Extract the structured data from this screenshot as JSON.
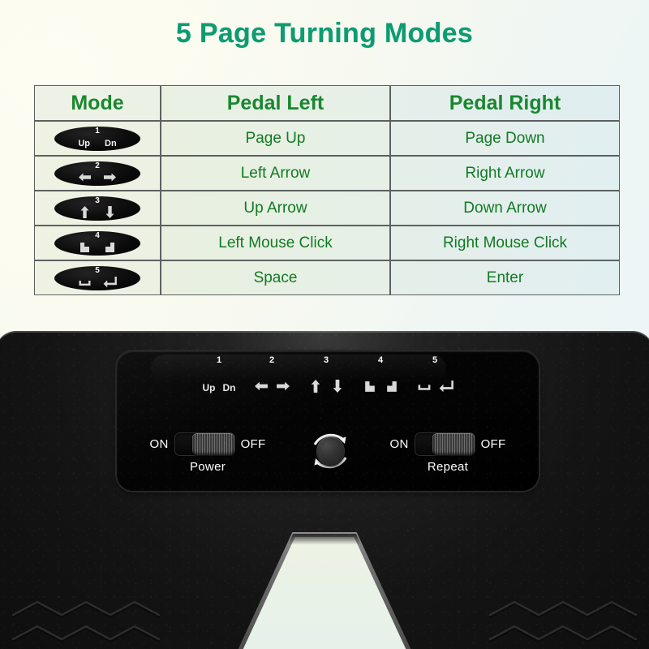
{
  "title": "5 Page Turning Modes",
  "colors": {
    "title": "#0d9b72",
    "header_text": "#19882f",
    "cell_text": "#117a22",
    "table_border": "#5c6160",
    "device_black": "#121212",
    "panel_text": "#ffffff"
  },
  "table": {
    "headers": {
      "mode": "Mode",
      "pedal_left": "Pedal Left",
      "pedal_right": "Pedal Right"
    },
    "rows": [
      {
        "number": "1",
        "icon_kind": "text",
        "icon_left_label": "Up",
        "icon_right_label": "Dn",
        "icon_left_name": "page-up-icon",
        "icon_right_name": "page-down-icon",
        "pedal_left": "Page Up",
        "pedal_right": "Page Down"
      },
      {
        "number": "2",
        "icon_kind": "arrow-lr",
        "icon_left_label": "",
        "icon_right_label": "",
        "icon_left_name": "arrow-left-icon",
        "icon_right_name": "arrow-right-icon",
        "pedal_left": "Left Arrow",
        "pedal_right": "Right Arrow"
      },
      {
        "number": "3",
        "icon_kind": "arrow-ud",
        "icon_left_label": "",
        "icon_right_label": "",
        "icon_left_name": "arrow-up-icon",
        "icon_right_name": "arrow-down-icon",
        "pedal_left": "Up Arrow",
        "pedal_right": "Down Arrow"
      },
      {
        "number": "4",
        "icon_kind": "mouse",
        "icon_left_label": "",
        "icon_right_label": "",
        "icon_left_name": "mouse-left-click-icon",
        "icon_right_name": "mouse-right-click-icon",
        "pedal_left": "Left Mouse Click",
        "pedal_right": "Right Mouse Click"
      },
      {
        "number": "5",
        "icon_kind": "space-enter",
        "icon_left_label": "",
        "icon_right_label": "",
        "icon_left_name": "space-bar-icon",
        "icon_right_name": "enter-key-icon",
        "pedal_left": "Space",
        "pedal_right": "Enter"
      }
    ]
  },
  "device": {
    "panel_legend": [
      {
        "number": "1",
        "left_text": "Up",
        "right_text": "Dn",
        "kind": "text"
      },
      {
        "number": "2",
        "left_text": "",
        "right_text": "",
        "kind": "arrow-lr"
      },
      {
        "number": "3",
        "left_text": "",
        "right_text": "",
        "kind": "arrow-ud"
      },
      {
        "number": "4",
        "left_text": "",
        "right_text": "",
        "kind": "mouse"
      },
      {
        "number": "5",
        "left_text": "",
        "right_text": "",
        "kind": "space-enter"
      }
    ],
    "power_switch": {
      "name": "Power",
      "on_label": "ON",
      "off_label": "OFF",
      "position": "OFF"
    },
    "repeat_switch": {
      "name": "Repeat",
      "on_label": "ON",
      "off_label": "OFF",
      "position": "OFF"
    },
    "cycle_button": {
      "name": "mode-cycle-button"
    }
  }
}
